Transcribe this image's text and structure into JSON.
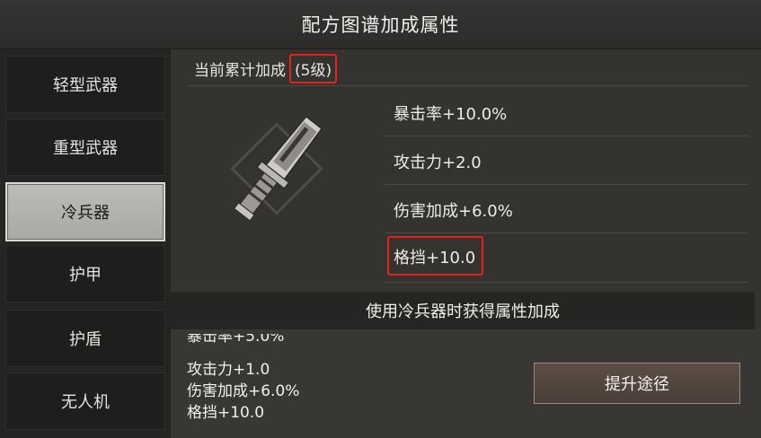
{
  "title": "配方图谱加成属性",
  "sidebar": {
    "tabs": [
      {
        "label": "轻型武器",
        "active": false
      },
      {
        "label": "重型武器",
        "active": false
      },
      {
        "label": "冷兵器",
        "active": true
      },
      {
        "label": "护甲",
        "active": false
      },
      {
        "label": "护盾",
        "active": false
      },
      {
        "label": "无人机",
        "active": false
      }
    ]
  },
  "current": {
    "label": "当前累计加成",
    "level": "(5级)"
  },
  "stats": [
    "暴击率+10.0%",
    "攻击力+2.0",
    "伤害加成+6.0%",
    "格挡+10.0"
  ],
  "banner": "使用冷兵器时获得属性加成",
  "next_list": [
    "暴击率+5.0%",
    "攻击力+1.0",
    "伤害加成+6.0%",
    "格挡+10.0"
  ],
  "upgrade_button": "提升途径",
  "colors": {
    "highlight": "#e0231d",
    "active_tab": "#b3b2ae"
  }
}
